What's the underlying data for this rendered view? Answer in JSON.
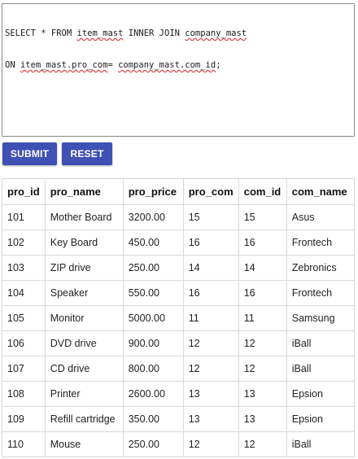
{
  "editor": {
    "line1": {
      "p1": "SELECT * FROM ",
      "w1": "item_mast",
      "p2": " INNER JOIN ",
      "w2": "company_mast"
    },
    "line2": {
      "p1": "ON ",
      "w1": "item_mast.pro_com",
      "p2": "= ",
      "w2": "company_mast.com_id",
      "p3": ";"
    }
  },
  "buttons": {
    "submit_label": "SUBMIT",
    "reset_label": "RESET",
    "color": "#3f51b5"
  },
  "table": {
    "columns": [
      "pro_id",
      "pro_name",
      "pro_price",
      "pro_com",
      "com_id",
      "com_name"
    ],
    "rows": [
      [
        "101",
        "Mother Board",
        "3200.00",
        "15",
        "15",
        "Asus"
      ],
      [
        "102",
        "Key Board",
        "450.00",
        "16",
        "16",
        "Frontech"
      ],
      [
        "103",
        "ZIP drive",
        "250.00",
        "14",
        "14",
        "Zebronics"
      ],
      [
        "104",
        "Speaker",
        "550.00",
        "16",
        "16",
        "Frontech"
      ],
      [
        "105",
        "Monitor",
        "5000.00",
        "11",
        "11",
        "Samsung"
      ],
      [
        "106",
        "DVD drive",
        "900.00",
        "12",
        "12",
        "iBall"
      ],
      [
        "107",
        "CD drive",
        "800.00",
        "12",
        "12",
        "iBall"
      ],
      [
        "108",
        "Printer",
        "2600.00",
        "13",
        "13",
        "Epsion"
      ],
      [
        "109",
        "Refill cartridge",
        "350.00",
        "13",
        "13",
        "Epsion"
      ],
      [
        "110",
        "Mouse",
        "250.00",
        "12",
        "12",
        "iBall"
      ]
    ]
  }
}
